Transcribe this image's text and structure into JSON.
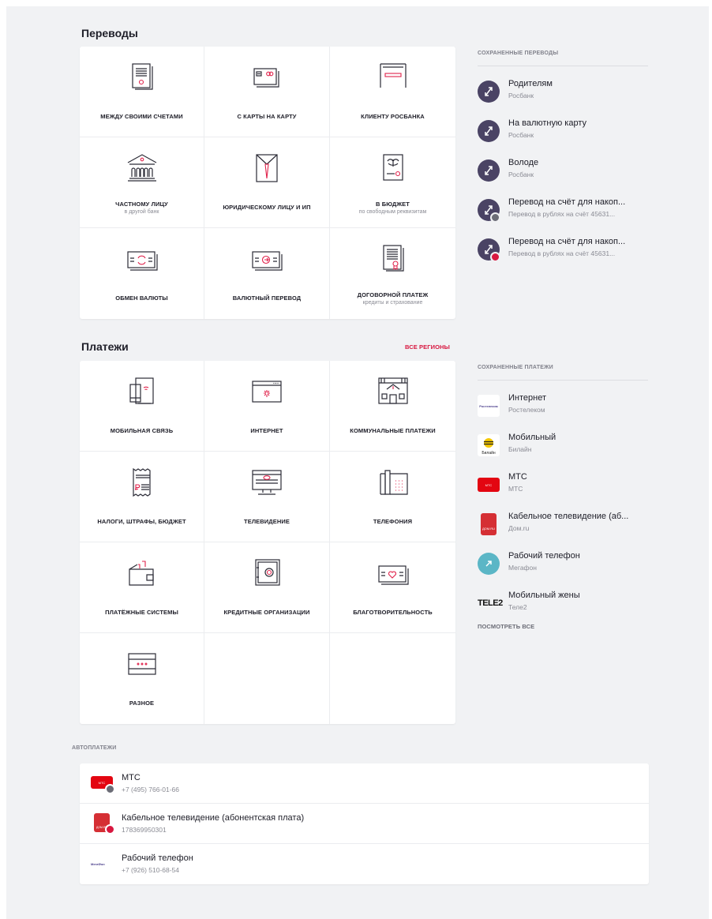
{
  "transfers": {
    "title": "Переводы",
    "tiles": [
      {
        "label": "Между своими счетами",
        "sub": ""
      },
      {
        "label": "С карты на карту",
        "sub": ""
      },
      {
        "label": "Клиенту Росбанка",
        "sub": ""
      },
      {
        "label": "Частному лицу",
        "sub": "в другой банк"
      },
      {
        "label": "Юридическому лицу и ИП",
        "sub": ""
      },
      {
        "label": "В бюджет",
        "sub": "по свободным реквизитам"
      },
      {
        "label": "Обмен валюты",
        "sub": ""
      },
      {
        "label": "Валютный перевод",
        "sub": ""
      },
      {
        "label": "Договорной платеж",
        "sub": "кредиты и страхование"
      }
    ]
  },
  "saved_transfers": {
    "title": "СОХРАНЕННЫЕ ПЕРЕВОДЫ",
    "items": [
      {
        "name": "Родителям",
        "sub": "Росбанк"
      },
      {
        "name": "На валютную карту",
        "sub": "Росбанк"
      },
      {
        "name": "Володе",
        "sub": "Росбанк"
      },
      {
        "name": "Перевод на счёт для накоп...",
        "sub": "Перевод в рублях на счёт 45631..."
      },
      {
        "name": "Перевод на счёт для накоп...",
        "sub": "Перевод в рублях на счёт 45631..."
      }
    ]
  },
  "payments": {
    "title": "Платежи",
    "regions_link": "ВСЕ РЕГИОНЫ",
    "tiles": [
      {
        "label": "Мобильная связь"
      },
      {
        "label": "Интернет"
      },
      {
        "label": "Коммунальные платежи"
      },
      {
        "label": "Налоги, штрафы, бюджет"
      },
      {
        "label": "Телевидение"
      },
      {
        "label": "Телефония"
      },
      {
        "label": "Платёжные системы"
      },
      {
        "label": "Кредитные организации"
      },
      {
        "label": "Благотворительность"
      },
      {
        "label": "Разное"
      }
    ]
  },
  "saved_payments": {
    "title": "СОХРАНЕННЫЕ ПЛАТЕЖИ",
    "items": [
      {
        "name": "Интернет",
        "sub": "Ростелеком",
        "logo_text": "Ростелеком"
      },
      {
        "name": "Мобильный",
        "sub": "Билайн",
        "logo_text": "Билайн"
      },
      {
        "name": "МТС",
        "sub": "МТС",
        "logo_text": "МТС"
      },
      {
        "name": "Кабельное телевидение (аб...",
        "sub": "Дом.ru",
        "logo_text": "ДОМ.RU"
      },
      {
        "name": "Рабочий телефон",
        "sub": "Мегафон",
        "logo_text": ""
      },
      {
        "name": "Мобильный жены",
        "sub": "Теле2",
        "logo_text": "TELE2"
      }
    ],
    "view_all": "ПОСМОТРЕТЬ ВСЕ"
  },
  "autopayments": {
    "title": "АВТОПЛАТЕЖИ",
    "items": [
      {
        "name": "МТС",
        "sub": "+7 (495) 766-01-66",
        "logo_text": "МТС"
      },
      {
        "name": "Кабельное телевидение (абонентская плата)",
        "sub": "178369950301",
        "logo_text": "ДОМ.RU"
      },
      {
        "name": "Рабочий телефон",
        "sub": "+7 (926) 510-68-54",
        "logo_text": "МегаФон"
      }
    ]
  },
  "colors": {
    "accent_red": "#d8173f",
    "transfer_avatar": "#4a4364",
    "megafon": "#5bb6c6",
    "mts_red": "#e30611",
    "domru_red": "#d52f34"
  }
}
